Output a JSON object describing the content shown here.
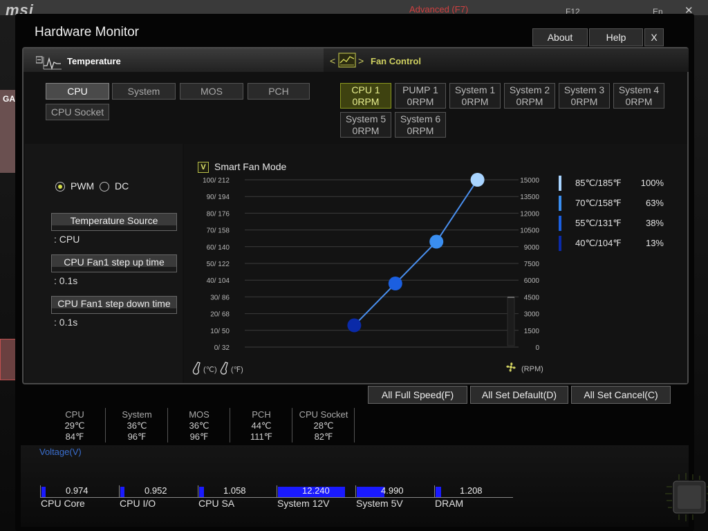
{
  "background": {
    "advanced_label": "Advanced (F7)",
    "f12_label": "F12",
    "lang_label": "En",
    "close": "✕",
    "side_tab": "GA",
    "logo": "msi"
  },
  "window": {
    "title": "Hardware Monitor",
    "about": "About",
    "help": "Help",
    "close": "X"
  },
  "temperature_tab": {
    "label": "Temperature",
    "sources": [
      "CPU",
      "System",
      "MOS",
      "PCH",
      "CPU Socket"
    ],
    "selected": "CPU"
  },
  "fan_tab": {
    "label": "Fan Control",
    "prev": "<",
    "next": ">",
    "fans": [
      {
        "name": "CPU 1",
        "rpm": "0RPM",
        "selected": true
      },
      {
        "name": "PUMP 1",
        "rpm": "0RPM"
      },
      {
        "name": "System 1",
        "rpm": "0RPM"
      },
      {
        "name": "System 2",
        "rpm": "0RPM"
      },
      {
        "name": "System 3",
        "rpm": "0RPM"
      },
      {
        "name": "System 4",
        "rpm": "0RPM"
      },
      {
        "name": "System 5",
        "rpm": "0RPM"
      },
      {
        "name": "System 6",
        "rpm": "0RPM"
      }
    ]
  },
  "control": {
    "pwm": "PWM",
    "dc": "DC",
    "mode_selected": "PWM",
    "temp_source_label": "Temperature Source",
    "temp_source_value": ": CPU",
    "step_up_label": "CPU Fan1 step up time",
    "step_up_value": ": 0.1s",
    "step_down_label": "CPU Fan1 step down time",
    "step_down_value": ": 0.1s"
  },
  "graph": {
    "smart_fan": "Smart Fan Mode",
    "check_mark": "V",
    "left_ticks": [
      "100/ 212",
      "90/ 194",
      "80/ 176",
      "70/ 158",
      "60/ 140",
      "50/ 122",
      "40/ 104",
      "30/  86",
      "20/  68",
      "10/  50",
      "0/  32"
    ],
    "right_ticks": [
      "15000",
      "13500",
      "12000",
      "10500",
      "9000",
      "7500",
      "6000",
      "4500",
      "3000",
      "1500",
      "0"
    ],
    "unit_c": "(℃)",
    "unit_f": "(℉)",
    "unit_rpm": "(RPM)"
  },
  "chart_data": {
    "type": "line",
    "x": [
      40,
      55,
      70,
      85
    ],
    "y": [
      13,
      38,
      63,
      100
    ],
    "xlim": [
      0,
      100
    ],
    "ylim": [
      0,
      100
    ],
    "legend": [
      {
        "temp": "85℃/185℉",
        "percent": "100%",
        "color": "#a8d4ff"
      },
      {
        "temp": "70℃/158℉",
        "percent": "63%",
        "color": "#3a8ef0"
      },
      {
        "temp": "55℃/131℉",
        "percent": "38%",
        "color": "#1b5fe0"
      },
      {
        "temp": "40℃/104℉",
        "percent": "13%",
        "color": "#0a2aa8"
      }
    ]
  },
  "actions": {
    "full_speed": "All Full Speed(F)",
    "set_default": "All Set Default(D)",
    "set_cancel": "All Set Cancel(C)"
  },
  "temps": [
    {
      "name": "CPU",
      "c": "29℃",
      "f": "84℉"
    },
    {
      "name": "System",
      "c": "36℃",
      "f": "96℉"
    },
    {
      "name": "MOS",
      "c": "36℃",
      "f": "96℉"
    },
    {
      "name": "PCH",
      "c": "44℃",
      "f": "111℉"
    },
    {
      "name": "CPU Socket",
      "c": "28℃",
      "f": "82℉"
    }
  ],
  "voltage": {
    "title": "Voltage(V)",
    "items": [
      {
        "name": "CPU Core",
        "value": "0.974",
        "level": 0.05
      },
      {
        "name": "CPU I/O",
        "value": "0.952",
        "level": 0.05
      },
      {
        "name": "CPU SA",
        "value": "1.058",
        "level": 0.06
      },
      {
        "name": "System 12V",
        "value": "12.240",
        "level": 0.88
      },
      {
        "name": "System 5V",
        "value": "4.990",
        "level": 0.36
      },
      {
        "name": "DRAM",
        "value": "1.208",
        "level": 0.07
      }
    ]
  }
}
